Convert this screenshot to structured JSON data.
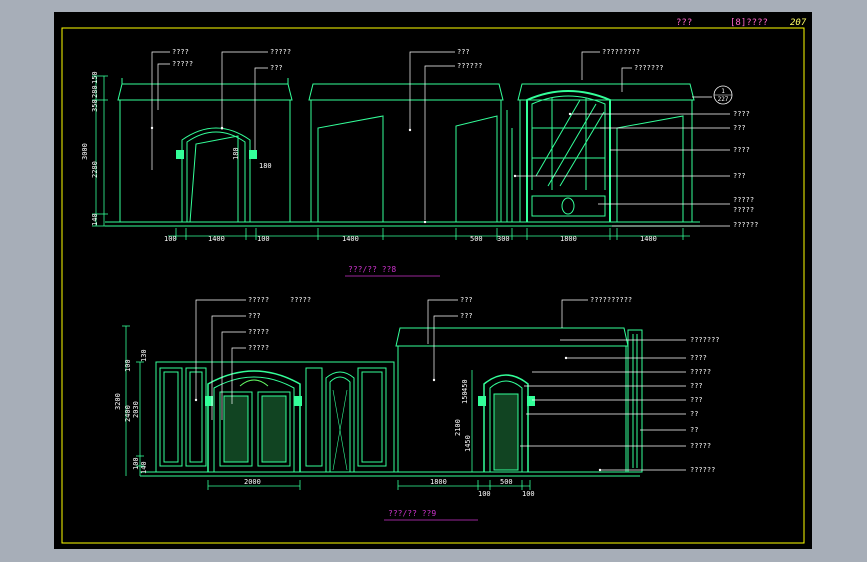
{
  "title_block": {
    "left": "???",
    "middle": "[8]????",
    "page_no": "207"
  },
  "elevation_top": {
    "callouts_left": [
      "????",
      "?????",
      "?????",
      "???",
      "???",
      "??????",
      "?????????",
      "???????"
    ],
    "callouts_right": [
      "????",
      "???",
      "????",
      "???",
      "?????",
      "?????",
      "??????"
    ],
    "index_symbol": {
      "top": "1",
      "bottom": "227"
    },
    "dims_bottom": [
      "100",
      "1400",
      "100",
      "1400",
      "500",
      "300",
      "1800",
      "1400"
    ],
    "dims_left": [
      "3000",
      "2280",
      "350",
      "280",
      "150",
      "140"
    ],
    "dims_inner": [
      "180",
      "180"
    ],
    "caption": "???/?? ??8"
  },
  "elevation_bottom": {
    "callouts_left": [
      "?????",
      "?????",
      "???",
      "?????",
      "?????",
      "???",
      "???",
      "??????????"
    ],
    "callouts_right": [
      "???????",
      "????",
      "?????",
      "???",
      "???",
      "??",
      "??",
      "?????",
      "??????"
    ],
    "dims_bottom": [
      "2000",
      "1800",
      "500",
      "100",
      "100"
    ],
    "dims_left": [
      "3200",
      "2400",
      "2030",
      "100",
      "130",
      "100",
      "140"
    ],
    "dims_inner": [
      "450",
      "150",
      "2100",
      "1450"
    ],
    "caption": "???/?? ??9"
  },
  "colors": {
    "sheet": "#000000",
    "frame": "#ffff00",
    "outline": "#33ff99",
    "leader": "#ffffff",
    "caption_underline": "#cc33cc",
    "dim_text": "#ffffff"
  }
}
